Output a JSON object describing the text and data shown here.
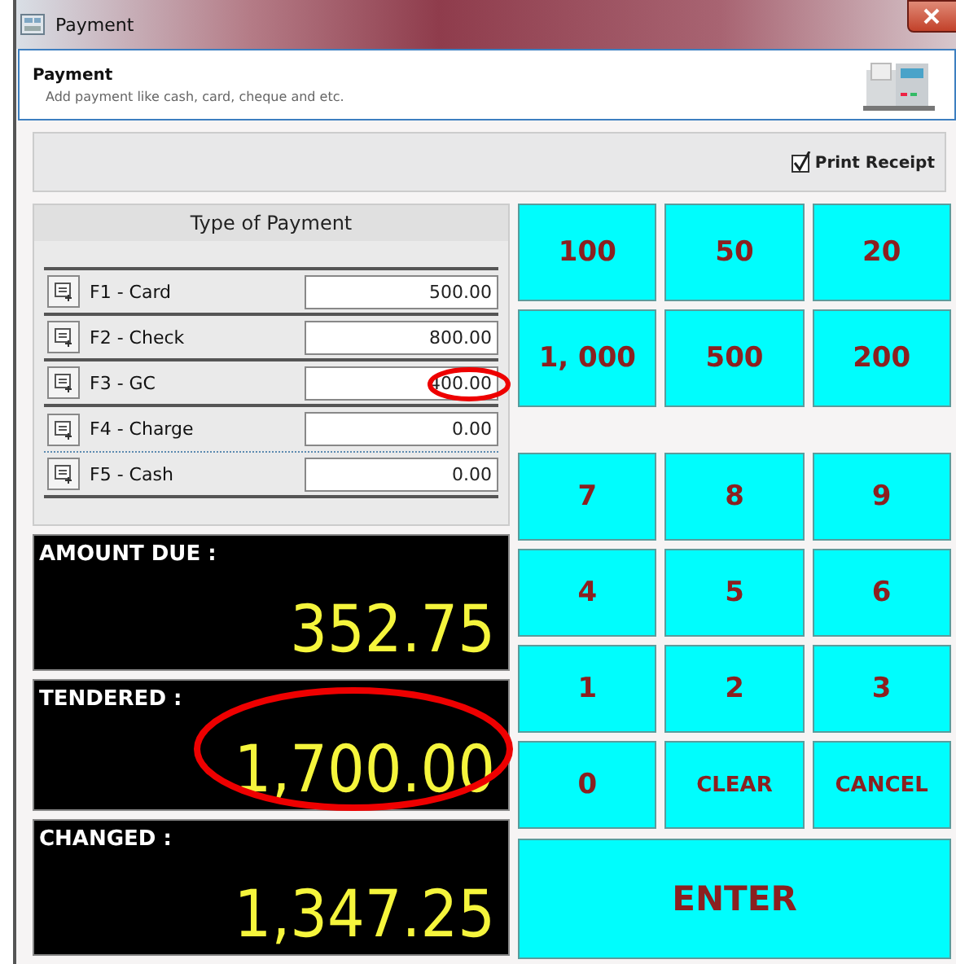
{
  "window": {
    "title": "Payment"
  },
  "header": {
    "title": "Payment",
    "subtitle": "Add payment like cash, card, cheque and etc."
  },
  "print_receipt": {
    "label": "Print Receipt",
    "checked": true
  },
  "payment_types": {
    "title": "Type of Payment",
    "rows": [
      {
        "label": "F1 - Card",
        "value": "500.00",
        "circled": false
      },
      {
        "label": "F2 - Check",
        "value": "800.00",
        "circled": false
      },
      {
        "label": "F3 - GC",
        "value": "400.00",
        "circled": true
      },
      {
        "label": "F4 - Charge",
        "value": "0.00",
        "circled": false
      },
      {
        "label": "F5 - Cash",
        "value": "0.00",
        "circled": false
      }
    ]
  },
  "displays": [
    {
      "label": "AMOUNT DUE :",
      "value": "352.75",
      "circled": false
    },
    {
      "label": "TENDERED :",
      "value": "1,700.00",
      "circled": true
    },
    {
      "label": "CHANGED :",
      "value": "1,347.25",
      "circled": false
    }
  ],
  "quick_amounts": [
    "100",
    "50",
    "20",
    "1, 000",
    "500",
    "200"
  ],
  "keypad": [
    "7",
    "8",
    "9",
    "4",
    "5",
    "6",
    "1",
    "2",
    "3",
    "0",
    "CLEAR",
    "CANCEL"
  ],
  "enter_button": "ENTER"
}
